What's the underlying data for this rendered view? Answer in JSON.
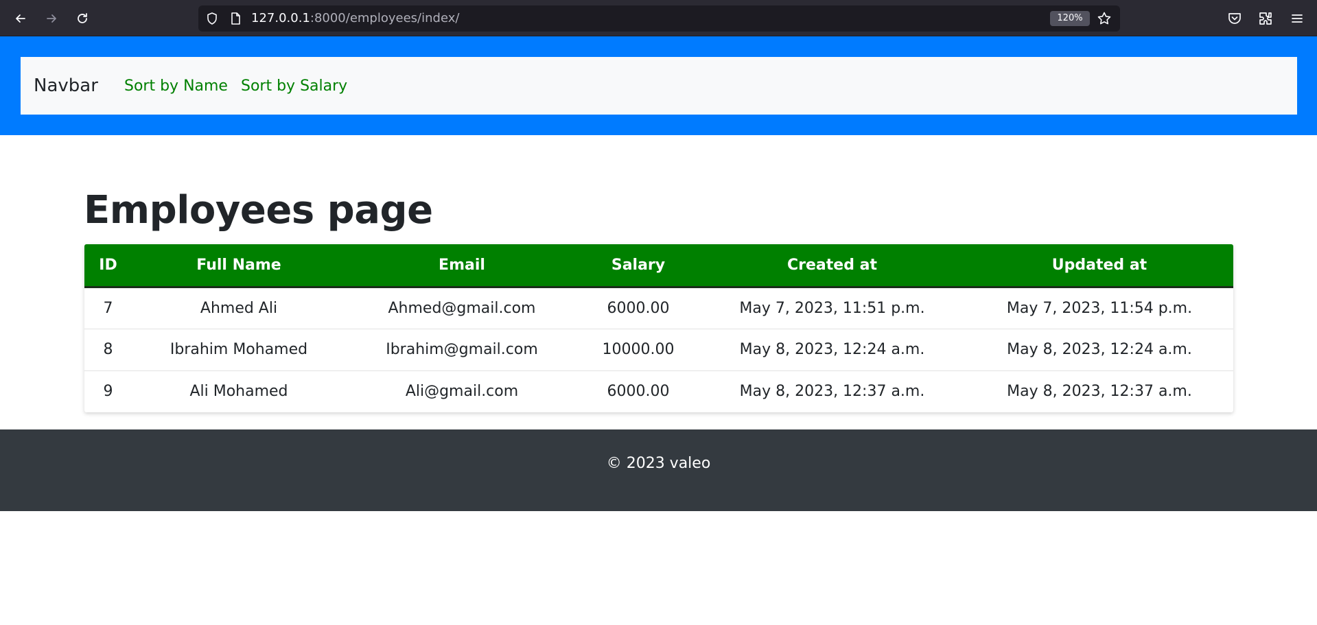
{
  "browser": {
    "url_host": "127.0.0.1",
    "url_path": ":8000/employees/index/",
    "zoom": "120%",
    "icons": [
      "back-icon",
      "forward-icon",
      "reload-icon",
      "shield-icon",
      "page-icon",
      "star-icon",
      "pocket-icon",
      "extensions-icon",
      "menu-icon"
    ]
  },
  "navbar": {
    "brand": "Navbar",
    "links": [
      "Sort by Name",
      "Sort by Salary"
    ]
  },
  "main": {
    "title": "Employees page",
    "table": {
      "headers": [
        "ID",
        "Full Name",
        "Email",
        "Salary",
        "Created at",
        "Updated at"
      ],
      "rows": [
        [
          "7",
          "Ahmed Ali",
          "Ahmed@gmail.com",
          "6000.00",
          "May 7, 2023, 11:51 p.m.",
          "May 7, 2023, 11:54 p.m."
        ],
        [
          "8",
          "Ibrahim Mohamed",
          "Ibrahim@gmail.com",
          "10000.00",
          "May 8, 2023, 12:24 a.m.",
          "May 8, 2023, 12:24 a.m."
        ],
        [
          "9",
          "Ali Mohamed",
          "Ali@gmail.com",
          "6000.00",
          "May 8, 2023, 12:37 a.m.",
          "May 8, 2023, 12:37 a.m."
        ]
      ]
    }
  },
  "footer": {
    "text": "© 2023 valeo"
  },
  "colors": {
    "header_bg": "#007bff",
    "navbar_bg": "#f8f9fa",
    "link": "#008000",
    "table_header_bg": "#008000",
    "footer_bg": "#343a40"
  }
}
